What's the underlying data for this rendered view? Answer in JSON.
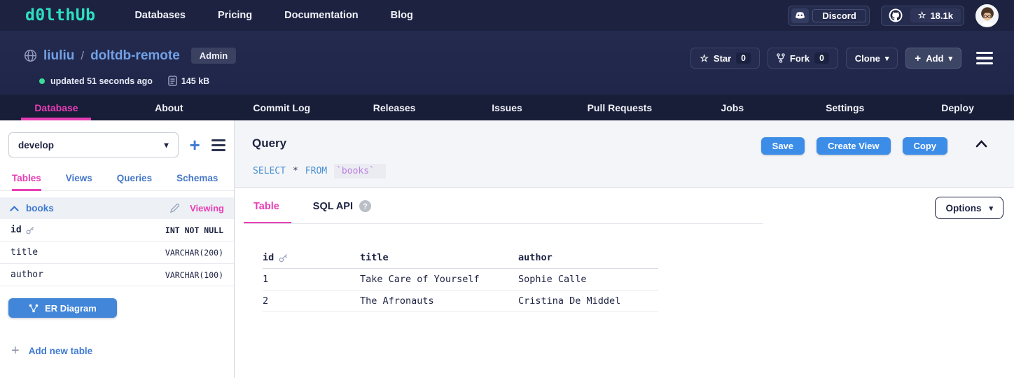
{
  "icons": {
    "star": "☆",
    "caret_down": "▾",
    "plus": "+",
    "question": "?"
  },
  "colors": {
    "accent_pink": "#e83eb6",
    "accent_blue": "#3f7ad1",
    "button_blue": "#3c8de8",
    "navy_dark": "#1d2342",
    "logo_teal": "#2ee0c2",
    "green_dot": "#3ddc97"
  },
  "navbar": {
    "logo": "d0lthUb",
    "links": [
      "Databases",
      "Pricing",
      "Documentation",
      "Blog"
    ],
    "discord_label": "Discord",
    "github_stars": "18.1k"
  },
  "repo": {
    "owner": "liuliu",
    "separator": "/",
    "name": "doltdb-remote",
    "badge": "Admin",
    "updated": "updated 51 seconds ago",
    "size": "145 kB",
    "star_label": "Star",
    "star_count": "0",
    "fork_label": "Fork",
    "fork_count": "0",
    "clone_label": "Clone",
    "add_label": "Add"
  },
  "tabs": {
    "items": [
      "Database",
      "About",
      "Commit Log",
      "Releases",
      "Issues",
      "Pull Requests",
      "Jobs",
      "Settings",
      "Deploy"
    ],
    "active": "Database"
  },
  "sidebar": {
    "branch": "develop",
    "tabs": [
      "Tables",
      "Views",
      "Queries",
      "Schemas"
    ],
    "active_tab": "Tables",
    "table": {
      "name": "books",
      "status": "Viewing",
      "columns": [
        {
          "name": "id",
          "type": "INT NOT NULL",
          "primary": true
        },
        {
          "name": "title",
          "type": "VARCHAR(200)",
          "primary": false
        },
        {
          "name": "author",
          "type": "VARCHAR(100)",
          "primary": false
        }
      ]
    },
    "er_button": "ER Diagram",
    "add_table": "Add new table"
  },
  "query": {
    "title": "Query",
    "sql": {
      "kw1": "SELECT",
      "star": "*",
      "kw2": "FROM",
      "table": "`books`"
    },
    "save": "Save",
    "create_view": "Create View",
    "copy": "Copy"
  },
  "results": {
    "tab_table": "Table",
    "tab_sql_api": "SQL API",
    "options": "Options",
    "table": {
      "headers": [
        "id",
        "title",
        "author"
      ],
      "rows": [
        [
          "1",
          "Take Care of Yourself",
          "Sophie Calle"
        ],
        [
          "2",
          "The Afronauts",
          "Cristina De Middel"
        ]
      ]
    }
  }
}
